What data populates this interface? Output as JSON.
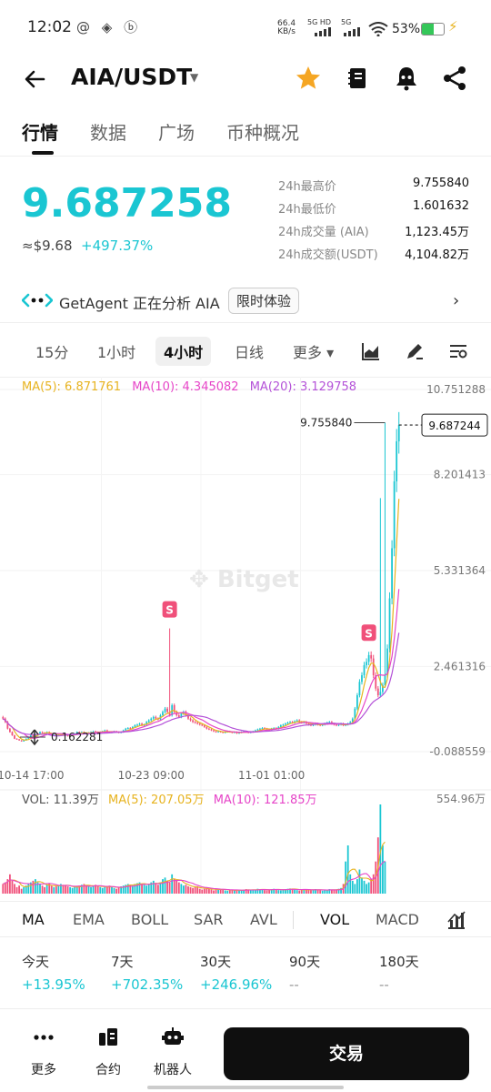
{
  "status": {
    "time": "12:02",
    "left_icons": "@ ◈ ⓑ",
    "net_speed": "66.4",
    "net_unit": "KB/s",
    "sig1": "5G HD",
    "sig2": "5G",
    "battery": "53%",
    "battery_level": 0.53
  },
  "header": {
    "pair": "AIA/USDT",
    "star_color": "#f5a623"
  },
  "tabs": [
    {
      "label": "行情"
    },
    {
      "label": "数据"
    },
    {
      "label": "广场"
    },
    {
      "label": "币种概况"
    }
  ],
  "price": {
    "last": "9.687258",
    "usd": "≈$9.68",
    "change": "+497.37%"
  },
  "stats": [
    {
      "label": "24h最高价",
      "value": "9.755840"
    },
    {
      "label": "24h最低价",
      "value": "1.601632"
    },
    {
      "label": "24h成交量 (AIA)",
      "value": "1,123.45万"
    },
    {
      "label": "24h成交额(USDT)",
      "value": "4,104.82万"
    }
  ],
  "agent": {
    "text": "GetAgent 正在分析 AIA",
    "badge": "限时体验",
    "chevron": "›"
  },
  "intervals": [
    {
      "label": "15分"
    },
    {
      "label": "1小时"
    },
    {
      "label": "4小时"
    },
    {
      "label": "日线"
    },
    {
      "label": "更多 ▾"
    }
  ],
  "ma": {
    "ma5": "MA(5): 6.871761",
    "ma10": "MA(10): 4.345082",
    "ma20": "MA(20): 3.129758"
  },
  "watermark": "✥ Bitget",
  "vol": {
    "vol": "VOL: 11.39万",
    "ma5": "MA(5): 207.05万",
    "ma10": "MA(10): 121.85万"
  },
  "chart_data": {
    "type": "line",
    "y_ticks": [
      "10.751288",
      "8.201413",
      "5.331364",
      "2.461316",
      "-0.088559"
    ],
    "y_tick_values": [
      10.751288,
      8.201413,
      5.331364,
      2.461316,
      -0.088559
    ],
    "ylim": [
      -0.088559,
      10.751288
    ],
    "x_ticks": [
      "10-14 17:00",
      "10-23 09:00",
      "11-01 01:00"
    ],
    "x_tick_index": [
      12,
      64,
      116
    ],
    "high_label": "9.755840",
    "last_label": "9.687244",
    "low_label": "0.162281",
    "high_value": 9.75584,
    "last_value": 9.687244,
    "low_value": 0.162281,
    "signal_markers": [
      {
        "index": 72,
        "label": "S"
      },
      {
        "index": 158,
        "label": "S"
      }
    ],
    "vol_max_label": "554.96万",
    "up_color": "#1ac6d2",
    "down_color": "#f0507a",
    "closes": [
      0.9,
      0.8,
      0.6,
      0.5,
      0.4,
      0.3,
      0.28,
      0.25,
      0.22,
      0.25,
      0.3,
      0.35,
      0.4,
      0.38,
      0.42,
      0.45,
      0.5,
      0.48,
      0.46,
      0.5,
      0.45,
      0.42,
      0.44,
      0.4,
      0.42,
      0.45,
      0.43,
      0.4,
      0.38,
      0.4,
      0.42,
      0.45,
      0.5,
      0.48,
      0.5,
      0.46,
      0.44,
      0.48,
      0.5,
      0.52,
      0.5,
      0.48,
      0.5,
      0.52,
      0.55,
      0.5,
      0.48,
      0.5,
      0.52,
      0.5,
      0.48,
      0.5,
      0.55,
      0.6,
      0.62,
      0.6,
      0.65,
      0.7,
      0.72,
      0.75,
      0.7,
      0.72,
      0.8,
      0.85,
      0.9,
      0.95,
      0.9,
      0.88,
      1.0,
      1.1,
      1.2,
      1.1,
      1.0,
      1.3,
      1.1,
      1.0,
      0.95,
      1.05,
      1.1,
      1.0,
      0.9,
      0.85,
      0.8,
      0.78,
      0.75,
      0.72,
      0.7,
      0.65,
      0.6,
      0.58,
      0.55,
      0.52,
      0.5,
      0.52,
      0.5,
      0.48,
      0.5,
      0.52,
      0.5,
      0.48,
      0.5,
      0.46,
      0.48,
      0.5,
      0.52,
      0.5,
      0.48,
      0.5,
      0.52,
      0.55,
      0.58,
      0.6,
      0.62,
      0.6,
      0.58,
      0.55,
      0.6,
      0.62,
      0.6,
      0.65,
      0.7,
      0.72,
      0.75,
      0.78,
      0.8,
      0.78,
      0.82,
      0.85,
      0.8,
      0.78,
      0.8,
      0.75,
      0.72,
      0.7,
      0.72,
      0.75,
      0.72,
      0.7,
      0.72,
      0.75,
      0.78,
      0.8,
      0.75,
      0.72,
      0.7,
      0.72,
      0.75,
      0.7,
      0.72,
      0.75,
      0.8,
      0.9,
      1.2,
      1.6,
      2.0,
      2.2,
      2.5,
      2.6,
      2.8,
      2.7,
      2.2,
      1.8,
      1.6,
      1.7,
      1.9,
      2.2,
      3.0,
      4.5,
      6.0,
      8.0,
      9.2,
      9.687
    ],
    "highs_extra": {
      "72": 3.6,
      "158": 2.9,
      "163": 7.5,
      "165": 9.756
    },
    "volumes": [
      60,
      70,
      90,
      120,
      80,
      60,
      40,
      50,
      30,
      40,
      50,
      60,
      70,
      80,
      90,
      70,
      60,
      50,
      40,
      55,
      60,
      50,
      40,
      45,
      50,
      60,
      55,
      50,
      45,
      40,
      35,
      40,
      45,
      50,
      55,
      60,
      50,
      45,
      40,
      50,
      55,
      45,
      40,
      35,
      40,
      45,
      50,
      40,
      35,
      30,
      40,
      45,
      50,
      55,
      60,
      55,
      50,
      60,
      65,
      70,
      60,
      55,
      50,
      60,
      70,
      80,
      60,
      55,
      70,
      90,
      100,
      80,
      70,
      120,
      90,
      80,
      70,
      60,
      50,
      55,
      45,
      40,
      35,
      40,
      45,
      30,
      25,
      30,
      35,
      30,
      25,
      20,
      25,
      30,
      28,
      25,
      20,
      18,
      22,
      25,
      20,
      18,
      22,
      20,
      25,
      28,
      24,
      20,
      22,
      25,
      30,
      28,
      25,
      22,
      20,
      25,
      28,
      30,
      25,
      22,
      20,
      25,
      28,
      30,
      32,
      28,
      25,
      22,
      20,
      25,
      28,
      24,
      20,
      22,
      25,
      28,
      24,
      20,
      18,
      22,
      25,
      28,
      24,
      20,
      25,
      30,
      35,
      60,
      200,
      300,
      120,
      80,
      60,
      90,
      150,
      100,
      80,
      60,
      70,
      90,
      120,
      200,
      350,
      554.96,
      300,
      200
    ]
  },
  "indicators": [
    {
      "label": "MA"
    },
    {
      "label": "EMA"
    },
    {
      "label": "BOLL"
    },
    {
      "label": "SAR"
    },
    {
      "label": "AVL"
    },
    {
      "label": "VOL"
    },
    {
      "label": "MACD"
    }
  ],
  "perf": [
    {
      "label": "今天",
      "value": "+13.95%"
    },
    {
      "label": "7天",
      "value": "+702.35%"
    },
    {
      "label": "30天",
      "value": "+246.96%"
    },
    {
      "label": "90天",
      "value": "--"
    },
    {
      "label": "180天",
      "value": "--"
    }
  ],
  "bottom": {
    "more": "更多",
    "contract": "合约",
    "bot": "机器人",
    "trade": "交易"
  }
}
